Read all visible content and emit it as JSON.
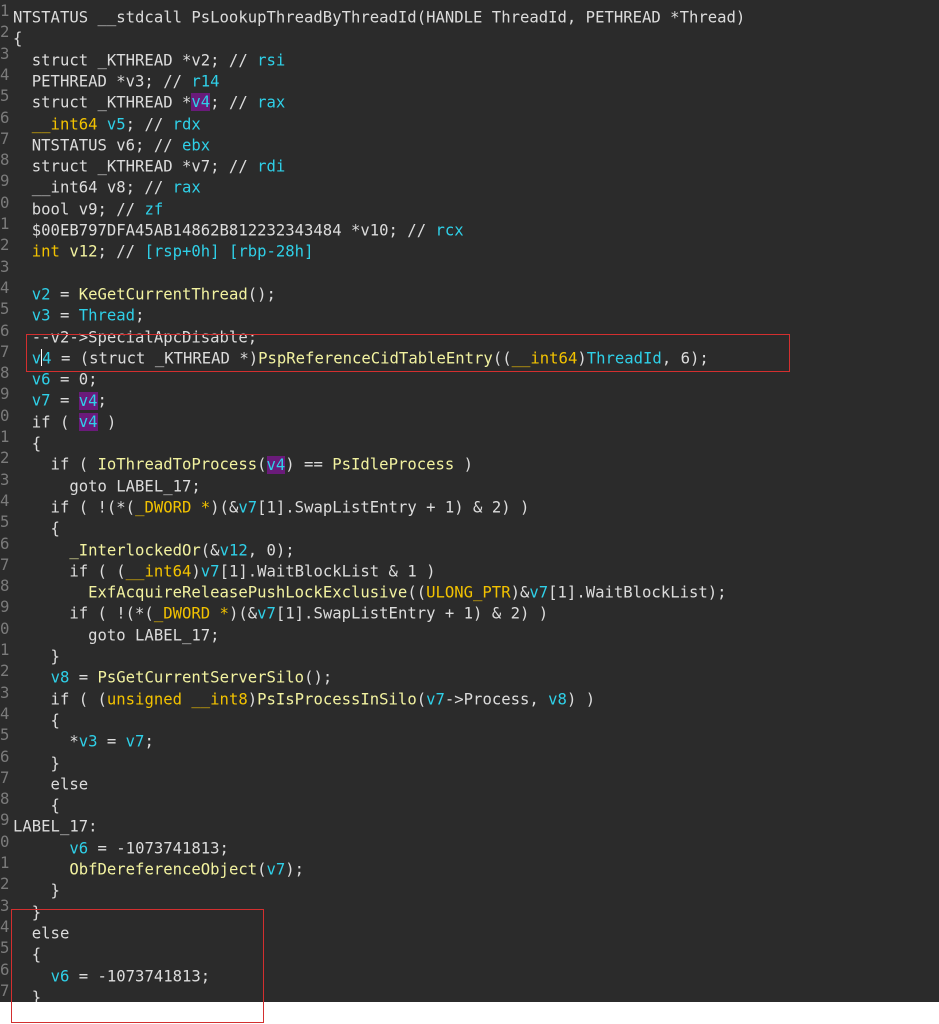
{
  "colors": {
    "background": "#2b2b2b",
    "line_numbers": "#7b7b7b",
    "text": "#dcdcdc",
    "variable": "#2fd0e8",
    "function": "#f2f2a0",
    "builtin_type": "#f2c200",
    "highlight": "#6a1b7a",
    "annotation_box": "#d32f2f"
  },
  "lines": [
    {
      "num": "1",
      "tokens": [
        {
          "t": "NTSTATUS __stdcall PsLookupThreadByThreadId(HANDLE ThreadId, PETHREAD *Thread)",
          "c": "plain"
        }
      ]
    },
    {
      "num": "2",
      "tokens": [
        {
          "t": "{",
          "c": "plain"
        }
      ]
    },
    {
      "num": "3",
      "tokens": [
        {
          "t": "  struct _KTHREAD *v2; // ",
          "c": "plain"
        },
        {
          "t": "rsi",
          "c": "reg"
        }
      ]
    },
    {
      "num": "4",
      "tokens": [
        {
          "t": "  PETHREAD *v3; // ",
          "c": "plain"
        },
        {
          "t": "r14",
          "c": "reg"
        }
      ]
    },
    {
      "num": "5",
      "tokens": [
        {
          "t": "  struct _KTHREAD *",
          "c": "plain"
        },
        {
          "t": "v4",
          "c": "hl"
        },
        {
          "t": "; // ",
          "c": "plain"
        },
        {
          "t": "rax",
          "c": "reg"
        }
      ]
    },
    {
      "num": "6",
      "tokens": [
        {
          "t": "  ",
          "c": "plain"
        },
        {
          "t": "__int64",
          "c": "builtin"
        },
        {
          "t": " ",
          "c": "plain"
        },
        {
          "t": "v5",
          "c": "var"
        },
        {
          "t": "; // ",
          "c": "plain"
        },
        {
          "t": "rdx",
          "c": "reg"
        }
      ]
    },
    {
      "num": "7",
      "tokens": [
        {
          "t": "  NTSTATUS v6; // ",
          "c": "plain"
        },
        {
          "t": "ebx",
          "c": "reg"
        }
      ]
    },
    {
      "num": "8",
      "tokens": [
        {
          "t": "  struct _KTHREAD *v7; // ",
          "c": "plain"
        },
        {
          "t": "rdi",
          "c": "reg"
        }
      ]
    },
    {
      "num": "9",
      "tokens": [
        {
          "t": "  __int64 v8; // ",
          "c": "plain"
        },
        {
          "t": "rax",
          "c": "reg"
        }
      ]
    },
    {
      "num": "0",
      "tokens": [
        {
          "t": "  bool v9; // ",
          "c": "plain"
        },
        {
          "t": "zf",
          "c": "reg"
        }
      ]
    },
    {
      "num": "1",
      "tokens": [
        {
          "t": "  $00EB797DFA45AB14862B812232343484 *v10; // ",
          "c": "plain"
        },
        {
          "t": "rcx",
          "c": "reg"
        }
      ]
    },
    {
      "num": "2",
      "tokens": [
        {
          "t": "  ",
          "c": "plain"
        },
        {
          "t": "int",
          "c": "builtin"
        },
        {
          "t": " ",
          "c": "plain"
        },
        {
          "t": "v12",
          "c": "func"
        },
        {
          "t": "; // ",
          "c": "plain"
        },
        {
          "t": "[rsp+0h] [rbp-28h]",
          "c": "reg"
        }
      ]
    },
    {
      "num": "3",
      "tokens": [
        {
          "t": "",
          "c": "plain"
        }
      ]
    },
    {
      "num": "4",
      "tokens": [
        {
          "t": "  ",
          "c": "plain"
        },
        {
          "t": "v2",
          "c": "var"
        },
        {
          "t": " = ",
          "c": "plain"
        },
        {
          "t": "KeGetCurrentThread",
          "c": "func"
        },
        {
          "t": "();",
          "c": "plain"
        }
      ]
    },
    {
      "num": "5",
      "tokens": [
        {
          "t": "  ",
          "c": "plain"
        },
        {
          "t": "v3",
          "c": "var"
        },
        {
          "t": " = ",
          "c": "plain"
        },
        {
          "t": "Thread",
          "c": "var"
        },
        {
          "t": ";",
          "c": "plain"
        }
      ]
    },
    {
      "num": "6",
      "tokens": [
        {
          "t": "  --v2->SpecialApcDisable;",
          "c": "plain"
        }
      ]
    },
    {
      "num": "7",
      "cursor": true,
      "tokens": [
        {
          "t": "  ",
          "c": "plain"
        },
        {
          "t": "v",
          "c": "var"
        },
        {
          "t": "4",
          "c": "var"
        },
        {
          "t": " = (struct _KTHREAD *)",
          "c": "plain"
        },
        {
          "t": "PspReferenceCidTableEntry",
          "c": "func"
        },
        {
          "t": "((",
          "c": "plain"
        },
        {
          "t": "__int64",
          "c": "builtin"
        },
        {
          "t": ")",
          "c": "plain"
        },
        {
          "t": "ThreadId",
          "c": "var"
        },
        {
          "t": ", 6);",
          "c": "plain"
        }
      ]
    },
    {
      "num": "8",
      "tokens": [
        {
          "t": "  ",
          "c": "plain"
        },
        {
          "t": "v6",
          "c": "var"
        },
        {
          "t": " = 0;",
          "c": "plain"
        }
      ]
    },
    {
      "num": "9",
      "tokens": [
        {
          "t": "  ",
          "c": "plain"
        },
        {
          "t": "v7",
          "c": "var"
        },
        {
          "t": " = ",
          "c": "plain"
        },
        {
          "t": "v4",
          "c": "hl"
        },
        {
          "t": ";",
          "c": "plain"
        }
      ]
    },
    {
      "num": "0",
      "tokens": [
        {
          "t": "  if ( ",
          "c": "plain"
        },
        {
          "t": "v4",
          "c": "hl"
        },
        {
          "t": " )",
          "c": "plain"
        }
      ]
    },
    {
      "num": "1",
      "tokens": [
        {
          "t": "  {",
          "c": "plain"
        }
      ]
    },
    {
      "num": "2",
      "tokens": [
        {
          "t": "    if ( ",
          "c": "plain"
        },
        {
          "t": "IoThreadToProcess",
          "c": "func"
        },
        {
          "t": "(",
          "c": "plain"
        },
        {
          "t": "v4",
          "c": "hl"
        },
        {
          "t": ") == ",
          "c": "plain"
        },
        {
          "t": "PsIdleProcess",
          "c": "func"
        },
        {
          "t": " )",
          "c": "plain"
        }
      ]
    },
    {
      "num": "3",
      "tokens": [
        {
          "t": "      goto LABEL_17;",
          "c": "plain"
        }
      ]
    },
    {
      "num": "4",
      "tokens": [
        {
          "t": "    if ( !(*(",
          "c": "plain"
        },
        {
          "t": "_DWORD *",
          "c": "builtin"
        },
        {
          "t": ")(&",
          "c": "plain"
        },
        {
          "t": "v7",
          "c": "var"
        },
        {
          "t": "[1].SwapListEntry + 1) & 2) )",
          "c": "plain"
        }
      ]
    },
    {
      "num": "5",
      "tokens": [
        {
          "t": "    {",
          "c": "plain"
        }
      ]
    },
    {
      "num": "6",
      "tokens": [
        {
          "t": "      ",
          "c": "plain"
        },
        {
          "t": "_InterlockedOr",
          "c": "func"
        },
        {
          "t": "(&",
          "c": "plain"
        },
        {
          "t": "v12",
          "c": "var"
        },
        {
          "t": ", 0);",
          "c": "plain"
        }
      ]
    },
    {
      "num": "7",
      "tokens": [
        {
          "t": "      if ( (",
          "c": "plain"
        },
        {
          "t": "__int64",
          "c": "builtin"
        },
        {
          "t": ")",
          "c": "plain"
        },
        {
          "t": "v7",
          "c": "var"
        },
        {
          "t": "[1].WaitBlockList & 1 )",
          "c": "plain"
        }
      ]
    },
    {
      "num": "8",
      "tokens": [
        {
          "t": "        ",
          "c": "plain"
        },
        {
          "t": "ExfAcquireReleasePushLockExclusive",
          "c": "func"
        },
        {
          "t": "((",
          "c": "plain"
        },
        {
          "t": "ULONG_PTR",
          "c": "builtin"
        },
        {
          "t": ")&",
          "c": "plain"
        },
        {
          "t": "v7",
          "c": "var"
        },
        {
          "t": "[1].WaitBlockList);",
          "c": "plain"
        }
      ]
    },
    {
      "num": "9",
      "tokens": [
        {
          "t": "      if ( !(*(",
          "c": "plain"
        },
        {
          "t": "_DWORD *",
          "c": "builtin"
        },
        {
          "t": ")(&",
          "c": "plain"
        },
        {
          "t": "v7",
          "c": "var"
        },
        {
          "t": "[1].SwapListEntry + 1) & 2) )",
          "c": "plain"
        }
      ]
    },
    {
      "num": "0",
      "tokens": [
        {
          "t": "        goto LABEL_17;",
          "c": "plain"
        }
      ]
    },
    {
      "num": "1",
      "tokens": [
        {
          "t": "    }",
          "c": "plain"
        }
      ]
    },
    {
      "num": "2",
      "tokens": [
        {
          "t": "    ",
          "c": "plain"
        },
        {
          "t": "v8",
          "c": "var"
        },
        {
          "t": " = ",
          "c": "plain"
        },
        {
          "t": "PsGetCurrentServerSilo",
          "c": "func"
        },
        {
          "t": "();",
          "c": "plain"
        }
      ]
    },
    {
      "num": "3",
      "tokens": [
        {
          "t": "    if ( (",
          "c": "plain"
        },
        {
          "t": "unsigned __int8",
          "c": "builtin"
        },
        {
          "t": ")",
          "c": "plain"
        },
        {
          "t": "PsIsProcessInSilo",
          "c": "func"
        },
        {
          "t": "(",
          "c": "plain"
        },
        {
          "t": "v7",
          "c": "var"
        },
        {
          "t": "->Process, ",
          "c": "plain"
        },
        {
          "t": "v8",
          "c": "var"
        },
        {
          "t": ") )",
          "c": "plain"
        }
      ]
    },
    {
      "num": "4",
      "tokens": [
        {
          "t": "    {",
          "c": "plain"
        }
      ]
    },
    {
      "num": "5",
      "tokens": [
        {
          "t": "      *",
          "c": "plain"
        },
        {
          "t": "v3",
          "c": "var"
        },
        {
          "t": " = ",
          "c": "plain"
        },
        {
          "t": "v7",
          "c": "var"
        },
        {
          "t": ";",
          "c": "plain"
        }
      ]
    },
    {
      "num": "6",
      "tokens": [
        {
          "t": "    }",
          "c": "plain"
        }
      ]
    },
    {
      "num": "7",
      "tokens": [
        {
          "t": "    else",
          "c": "plain"
        }
      ]
    },
    {
      "num": "8",
      "tokens": [
        {
          "t": "    {",
          "c": "plain"
        }
      ]
    },
    {
      "num": "9",
      "tokens": [
        {
          "t": "LABEL_17:",
          "c": "plain"
        }
      ]
    },
    {
      "num": "0",
      "tokens": [
        {
          "t": "      ",
          "c": "plain"
        },
        {
          "t": "v6",
          "c": "var"
        },
        {
          "t": " = -1073741813;",
          "c": "plain"
        }
      ]
    },
    {
      "num": "1",
      "tokens": [
        {
          "t": "      ",
          "c": "plain"
        },
        {
          "t": "ObfDereferenceObject",
          "c": "func"
        },
        {
          "t": "(",
          "c": "plain"
        },
        {
          "t": "v7",
          "c": "var"
        },
        {
          "t": ");",
          "c": "plain"
        }
      ]
    },
    {
      "num": "2",
      "tokens": [
        {
          "t": "    }",
          "c": "plain"
        }
      ]
    },
    {
      "num": "3",
      "tokens": [
        {
          "t": "  }",
          "c": "plain"
        }
      ]
    },
    {
      "num": "4",
      "tokens": [
        {
          "t": "  else",
          "c": "plain"
        }
      ]
    },
    {
      "num": "5",
      "tokens": [
        {
          "t": "  {",
          "c": "plain"
        }
      ]
    },
    {
      "num": "6",
      "tokens": [
        {
          "t": "    ",
          "c": "plain"
        },
        {
          "t": "v6",
          "c": "var"
        },
        {
          "t": " = -1073741813;",
          "c": "plain"
        }
      ]
    },
    {
      "num": "7",
      "tokens": [
        {
          "t": "  }",
          "c": "plain"
        }
      ]
    }
  ]
}
